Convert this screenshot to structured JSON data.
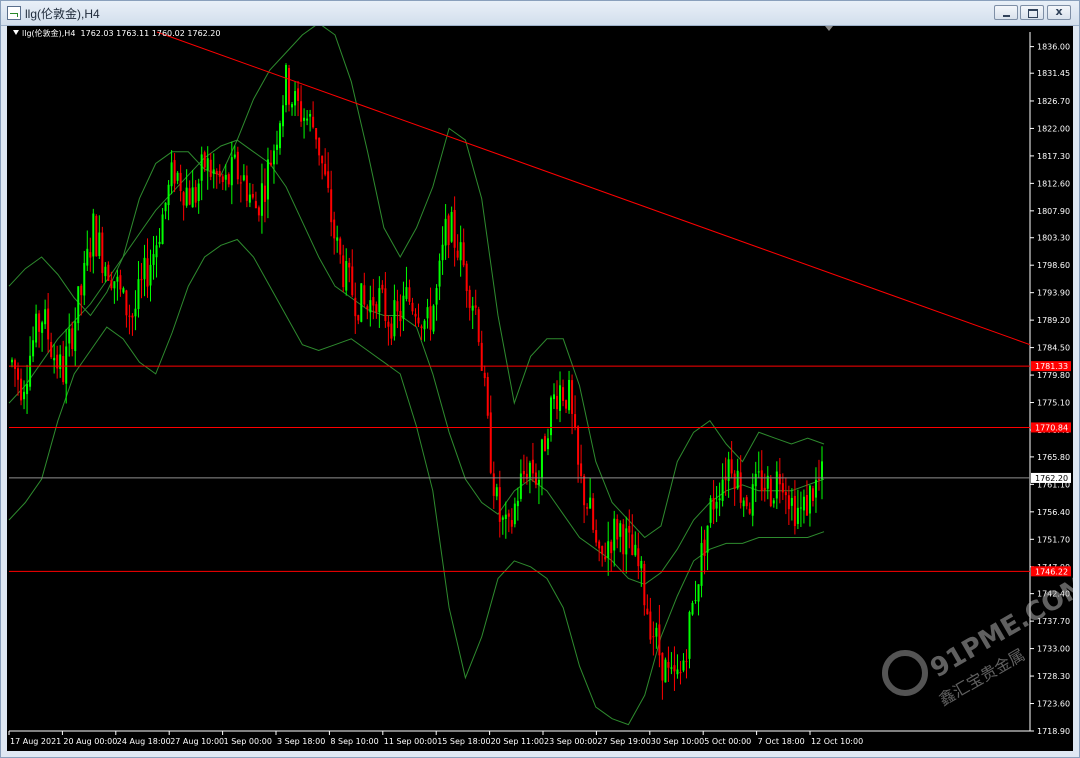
{
  "window": {
    "title": "llg(伦敦金),H4",
    "controls": [
      "minimize",
      "maximize",
      "close"
    ],
    "close_glyph": "x"
  },
  "header": {
    "symbol": "llg(伦敦金),H4",
    "ohlc": "1762.03 1763.11 1760.02 1762.20"
  },
  "watermark": {
    "text": "91PME.COM",
    "subtext": "鑫汇宝贵金属"
  },
  "colors": {
    "background": "#000000",
    "bull": "#00ff00",
    "bear": "#ff0000",
    "bands": "#2e8b2e",
    "axis_text": "#ffffff",
    "level_line": "#ff0000",
    "bid_line": "#8f8f8f"
  },
  "chart_data": {
    "type": "candlestick",
    "timeframe": "H4",
    "ylim": [
      1718.9,
      1838.5
    ],
    "y_ticks": [
      "1836.00",
      "1831.45",
      "1826.70",
      "1822.00",
      "1817.30",
      "1812.60",
      "1807.90",
      "1803.30",
      "1798.60",
      "1793.90",
      "1789.20",
      "1784.50",
      "1779.80",
      "1775.10",
      "1770.40",
      "1765.80",
      "1761.10",
      "1756.40",
      "1751.70",
      "1747.00",
      "1742.40",
      "1737.70",
      "1733.00",
      "1728.30",
      "1723.60",
      "1718.90"
    ],
    "x_labels": [
      "17 Aug 2021",
      "20 Aug 00:00",
      "24 Aug 18:00",
      "27 Aug 10:00",
      "1 Sep 00:00",
      "3 Sep 18:00",
      "8 Sep 10:00",
      "11 Sep 00:00",
      "15 Sep 18:00",
      "20 Sep 11:00",
      "23 Sep 00:00",
      "27 Sep 19:00",
      "30 Sep 10:00",
      "5 Oct 00:00",
      "7 Oct 18:00",
      "12 Oct 10:00"
    ],
    "price_path": [
      1782,
      1778,
      1785,
      1790,
      1784,
      1780,
      1788,
      1795,
      1805,
      1800,
      1797,
      1792,
      1790,
      1796,
      1801,
      1808,
      1815,
      1812,
      1810,
      1816,
      1814,
      1812,
      1815,
      1813,
      1808,
      1813,
      1820,
      1830,
      1826,
      1824,
      1822,
      1812,
      1802,
      1796,
      1793,
      1791,
      1794,
      1790,
      1789,
      1793,
      1792,
      1788,
      1794,
      1806,
      1802,
      1796,
      1790,
      1770,
      1756,
      1752,
      1760,
      1765,
      1762,
      1773,
      1778,
      1776,
      1762,
      1757,
      1747,
      1752,
      1754,
      1750,
      1746,
      1738,
      1732,
      1727,
      1728,
      1738,
      1748,
      1757,
      1762,
      1766,
      1760,
      1758,
      1762,
      1760,
      1764,
      1758,
      1756,
      1760,
      1762
    ],
    "bollinger_upper": [
      1795,
      1798,
      1800,
      1797,
      1793,
      1790,
      1794,
      1800,
      1810,
      1816,
      1818,
      1818,
      1815,
      1814,
      1820,
      1827,
      1832,
      1835,
      1838,
      1840,
      1838,
      1830,
      1818,
      1805,
      1800,
      1805,
      1812,
      1822,
      1820,
      1810,
      1790,
      1775,
      1783,
      1786,
      1786,
      1778,
      1765,
      1758,
      1755,
      1752,
      1754,
      1765,
      1770,
      1772,
      1768,
      1765,
      1770,
      1769,
      1768,
      1769,
      1768
    ],
    "bollinger_middle": [
      1775,
      1778,
      1782,
      1786,
      1789,
      1792,
      1796,
      1800,
      1804,
      1808,
      1811,
      1814,
      1817,
      1819,
      1820,
      1818,
      1816,
      1812,
      1806,
      1800,
      1795,
      1793,
      1791,
      1790,
      1790,
      1788,
      1780,
      1770,
      1762,
      1758,
      1756,
      1760,
      1762,
      1760,
      1756,
      1752,
      1750,
      1748,
      1745,
      1744,
      1746,
      1750,
      1755,
      1758,
      1760,
      1761,
      1760,
      1760,
      1760,
      1761,
      1762
    ],
    "bollinger_lower": [
      1755,
      1758,
      1762,
      1772,
      1780,
      1784,
      1788,
      1786,
      1782,
      1780,
      1787,
      1795,
      1800,
      1802,
      1803,
      1800,
      1795,
      1790,
      1785,
      1784,
      1785,
      1786,
      1784,
      1782,
      1780,
      1771,
      1760,
      1740,
      1728,
      1735,
      1745,
      1748,
      1747,
      1745,
      1740,
      1730,
      1723,
      1721,
      1720,
      1725,
      1735,
      1742,
      1748,
      1750,
      1751,
      1751,
      1752,
      1752,
      1752,
      1752,
      1753
    ],
    "horizontal_levels": [
      {
        "price": 1781.33,
        "label": "1781.33"
      },
      {
        "price": 1770.84,
        "label": "1770.84"
      },
      {
        "price": 1746.22,
        "label": "1746.22"
      }
    ],
    "bid_price": {
      "price": 1762.2,
      "label": "1762.20"
    },
    "trendline": {
      "from": {
        "time": "27 Aug 10:00",
        "price": 1838.5
      },
      "to": {
        "time": "12 Oct 10:00",
        "price": 1785.0
      }
    }
  }
}
